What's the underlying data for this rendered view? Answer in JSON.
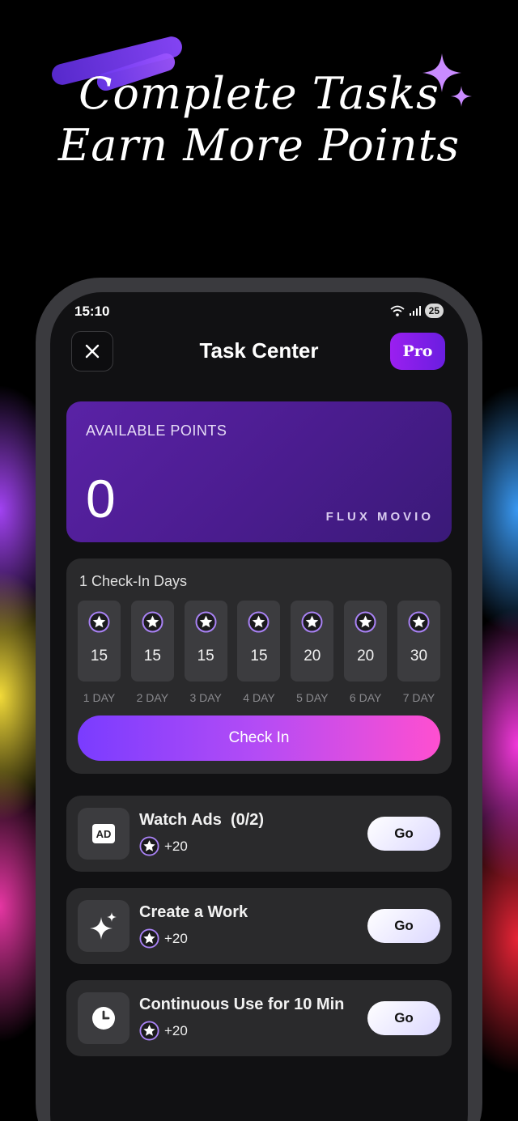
{
  "promo": {
    "line1": "Complete Tasks",
    "line2": "Earn More Points"
  },
  "status_bar": {
    "time": "15:10",
    "battery": "25"
  },
  "header": {
    "title": "Task Center",
    "pro_label": "Pro"
  },
  "points_card": {
    "label": "AVAILABLE POINTS",
    "value": "0",
    "brand": "FLUX MOVIO"
  },
  "checkin": {
    "title": "1 Check-In Days",
    "days": [
      {
        "value": "15",
        "label": "1 DAY"
      },
      {
        "value": "15",
        "label": "2 DAY"
      },
      {
        "value": "15",
        "label": "3 DAY"
      },
      {
        "value": "15",
        "label": "4 DAY"
      },
      {
        "value": "20",
        "label": "5 DAY"
      },
      {
        "value": "20",
        "label": "6 DAY"
      },
      {
        "value": "30",
        "label": "7 DAY"
      }
    ],
    "button_label": "Check In"
  },
  "tasks": [
    {
      "name": "Watch Ads  (0/2)",
      "reward": "+20",
      "button": "Go",
      "icon": "ad-icon"
    },
    {
      "name": "Create a Work",
      "reward": "+20",
      "button": "Go",
      "icon": "sparkle-icon"
    },
    {
      "name": "Continuous Use for 10 Min",
      "reward": "+20",
      "button": "Go",
      "icon": "clock-icon"
    }
  ],
  "colors": {
    "accent_purple": "#7a3cff",
    "accent_pink": "#ff4fd0",
    "card_bg": "#2a2a2c",
    "points_card": "#5a22a6"
  }
}
